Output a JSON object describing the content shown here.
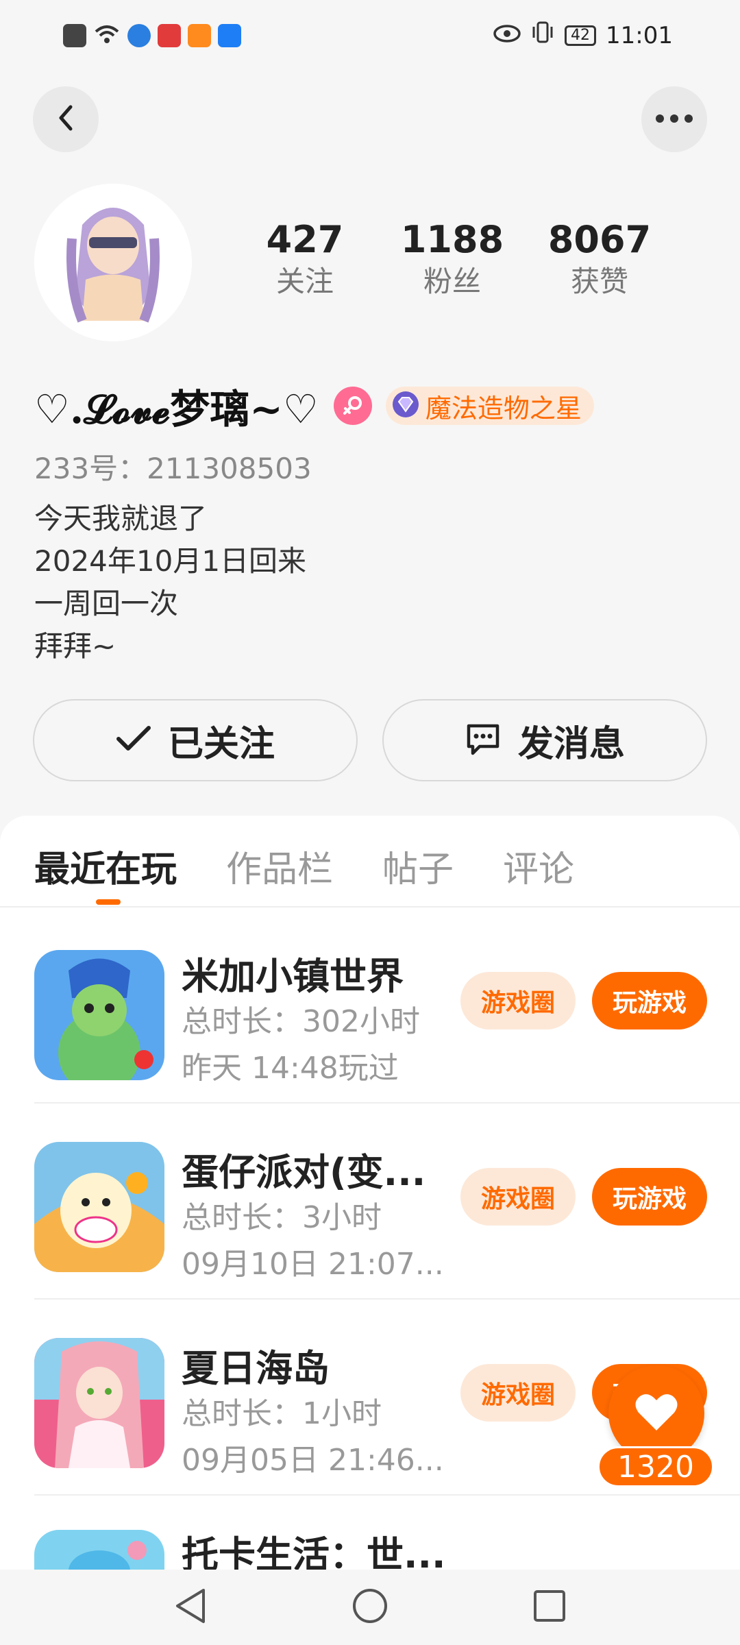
{
  "status_bar": {
    "time": "11:01",
    "battery": "42"
  },
  "profile": {
    "following_count": "427",
    "following_label": "关注",
    "fans_count": "1188",
    "fans_label": "粉丝",
    "likes_count": "8067",
    "likes_label": "获赞",
    "username": "♡.𝓛𝓸𝓿𝓮梦璃~♡",
    "medal": "魔法造物之星",
    "uid": "233号：211308503",
    "bio": [
      "今天我就退了",
      "2024年10月1日回来",
      "一周回一次",
      "拜拜~"
    ]
  },
  "actions": {
    "follow_label": "已关注",
    "message_label": "发消息"
  },
  "tabs": [
    {
      "label": "最近在玩",
      "active": true
    },
    {
      "label": "作品栏",
      "active": false
    },
    {
      "label": "帖子",
      "active": false
    },
    {
      "label": "评论",
      "active": false
    }
  ],
  "games": [
    {
      "name": "米加小镇世界",
      "duration": "总时长：302小时",
      "last_played": "昨天 14:48玩过",
      "circle_label": "游戏圈",
      "play_label": "玩游戏"
    },
    {
      "name": "蛋仔派对(变...",
      "duration": "总时长：3小时",
      "last_played": "09月10日 21:07...",
      "circle_label": "游戏圈",
      "play_label": "玩游戏"
    },
    {
      "name": "夏日海岛",
      "duration": "总时长：1小时",
      "last_played": "09月05日 21:46...",
      "circle_label": "游戏圈",
      "play_label": "玩游戏"
    },
    {
      "name": "托卡生活：世...",
      "duration": "",
      "last_played": "",
      "circle_label": "",
      "play_label": ""
    }
  ],
  "float_like": {
    "count": "1320"
  },
  "colors": {
    "accent": "#ff6a00",
    "accent_light": "#fde8d8",
    "background": "#f6f6f6"
  }
}
